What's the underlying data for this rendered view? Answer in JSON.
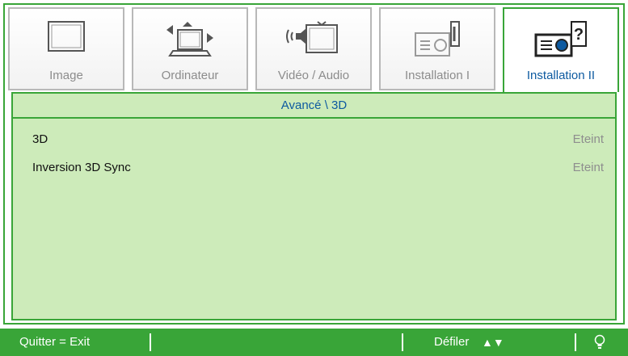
{
  "tabs": [
    {
      "label": "Image",
      "icon": "monitor-icon"
    },
    {
      "label": "Ordinateur",
      "icon": "computer-icon"
    },
    {
      "label": "Vidéo / Audio",
      "icon": "video-audio-icon"
    },
    {
      "label": "Installation I",
      "icon": "projector-icon"
    },
    {
      "label": "Installation II",
      "icon": "projector-settings-icon",
      "active": true
    }
  ],
  "breadcrumb": "Avancé \\ 3D",
  "rows": [
    {
      "label": "3D",
      "value": "Eteint"
    },
    {
      "label": "Inversion 3D Sync",
      "value": "Eteint"
    }
  ],
  "footer": {
    "exit": "Quitter = Exit",
    "scroll": "Défiler",
    "scroll_arrows": "▲▼"
  },
  "colors": {
    "accent": "#39a538",
    "panel": "#cdebba",
    "active_text": "#0d5aa0",
    "inactive_text": "#8c8c8c"
  }
}
